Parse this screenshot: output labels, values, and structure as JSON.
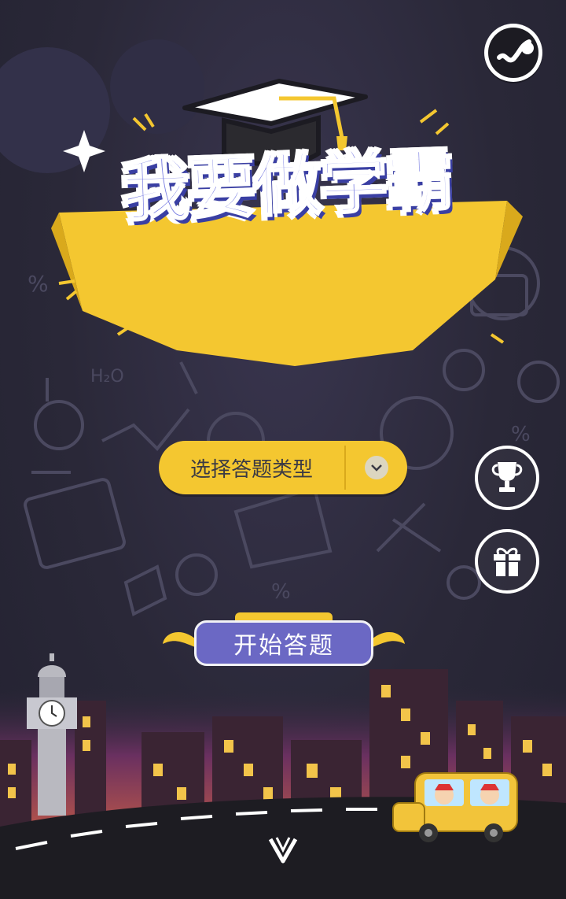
{
  "title": {
    "text": "我要做学霸"
  },
  "select": {
    "label": "选择答题类型"
  },
  "start": {
    "label": "开始答题"
  },
  "icons": {
    "music": "music-icon",
    "trophy": "trophy-icon",
    "gift": "gift-icon",
    "chevron": "chevron-down-icon",
    "down_arrow": "down-arrow-icon"
  },
  "colors": {
    "accent_yellow": "#f4c730",
    "title_purple": "#7b7fe2",
    "button_purple": "#6b68c4",
    "background": "#2a2838"
  }
}
